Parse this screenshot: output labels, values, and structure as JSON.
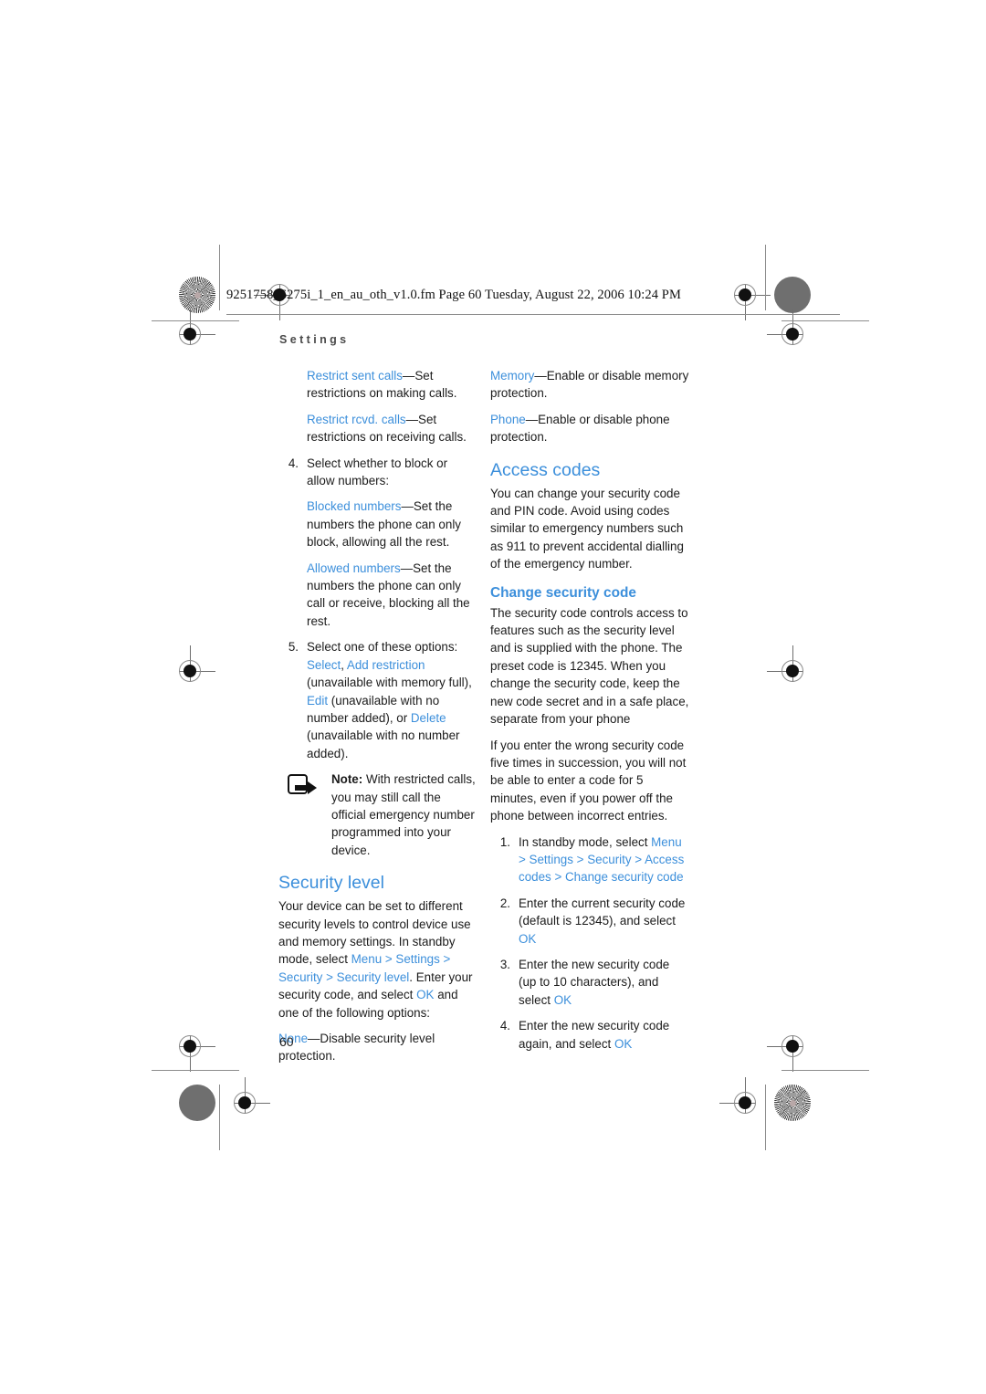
{
  "header": {
    "file_line": "9251758_6275i_1_en_au_oth_v1.0.fm  Page 60  Tuesday, August 22, 2006  10:24 PM",
    "running_head": "Settings"
  },
  "page_number": "60",
  "colors": {
    "accent_blue": "#3c8fdb",
    "body_text": "#1b1b1b",
    "running_head": "#4a4a4a"
  },
  "left_column": {
    "term_restrict_sent": {
      "term": "Restrict sent calls",
      "dash": "—",
      "desc": "Set restrictions on making calls."
    },
    "term_restrict_rcvd": {
      "term": "Restrict rcvd. calls",
      "dash": "—",
      "desc": "Set restrictions on receiving calls."
    },
    "step4": {
      "num": "4.",
      "text": "Select whether to block or allow numbers:"
    },
    "term_blocked": {
      "term": "Blocked numbers",
      "dash": "—",
      "desc": "Set the numbers the phone can only block, allowing all the rest."
    },
    "term_allowed": {
      "term": "Allowed numbers",
      "dash": "—",
      "desc": "Set the numbers the phone can only call or receive, blocking all the rest."
    },
    "step5": {
      "num": "5.",
      "lead": "Select one of these options: ",
      "opt_select": "Select",
      "sep1": ", ",
      "opt_add": "Add restriction",
      "paren1": " (unavailable with memory full), ",
      "opt_edit": "Edit",
      "paren2": " (unavailable with no number added), or ",
      "opt_delete": "Delete",
      "paren3": " (unavailable with no number added)."
    },
    "note": {
      "icon": "note-arrow-icon",
      "label": "Note:",
      "text": " With restricted calls, you may still call the official emergency number programmed into your device."
    },
    "security_level": {
      "heading": "Security level",
      "para_a": "Your device can be set to different security levels to control device use and memory settings. In standby mode, select ",
      "nav_menu": "Menu",
      "gt1": " > ",
      "nav_settings": "Settings",
      "gt2": " > ",
      "nav_security": "Security",
      "gt3": " > ",
      "nav_security_level": "Security level",
      "para_b": ". Enter your security code, and select ",
      "ok": "OK",
      "para_c": " and one of the following options:",
      "term_none": "None",
      "dash": "—",
      "desc_none": "Disable security level protection."
    }
  },
  "right_column": {
    "term_memory": {
      "term": "Memory",
      "dash": "—",
      "desc": "Enable or disable memory protection."
    },
    "term_phone": {
      "term": "Phone",
      "dash": "—",
      "desc": "Enable or disable phone protection."
    },
    "access_codes": {
      "heading": "Access codes",
      "para": "You can change your security code and PIN code. Avoid using codes similar to emergency numbers such as 911 to prevent accidental dialling of the emergency number."
    },
    "change_security_code": {
      "heading": "Change security code",
      "para_a": "The security code controls access to features such as the security level and is supplied with the phone. The preset code is 12345. When you change the security code, keep the new code secret and in a safe place, separate from your phone",
      "para_b": "If you enter the wrong security code five times in succession, you will not be able to enter a code for 5 minutes, even if you power off the phone between incorrect entries.",
      "step1": {
        "num": "1.",
        "lead": "In standby mode, select ",
        "nav_menu": "Menu",
        "gt1": " > ",
        "nav_settings": "Settings",
        "gt2": " > ",
        "nav_security": "Security",
        "gt3": " > ",
        "nav_access_codes": "Access codes",
        "gt4": " > ",
        "nav_change_security_code": "Change security code"
      },
      "step2": {
        "num": "2.",
        "lead": "Enter the current security code (default is 12345), and select ",
        "ok": "OK"
      },
      "step3": {
        "num": "3.",
        "lead": "Enter the new security code (up to 10 characters), and select ",
        "ok": "OK"
      },
      "step4": {
        "num": "4.",
        "lead": "Enter the new security code again, and select ",
        "ok": "OK"
      }
    }
  }
}
